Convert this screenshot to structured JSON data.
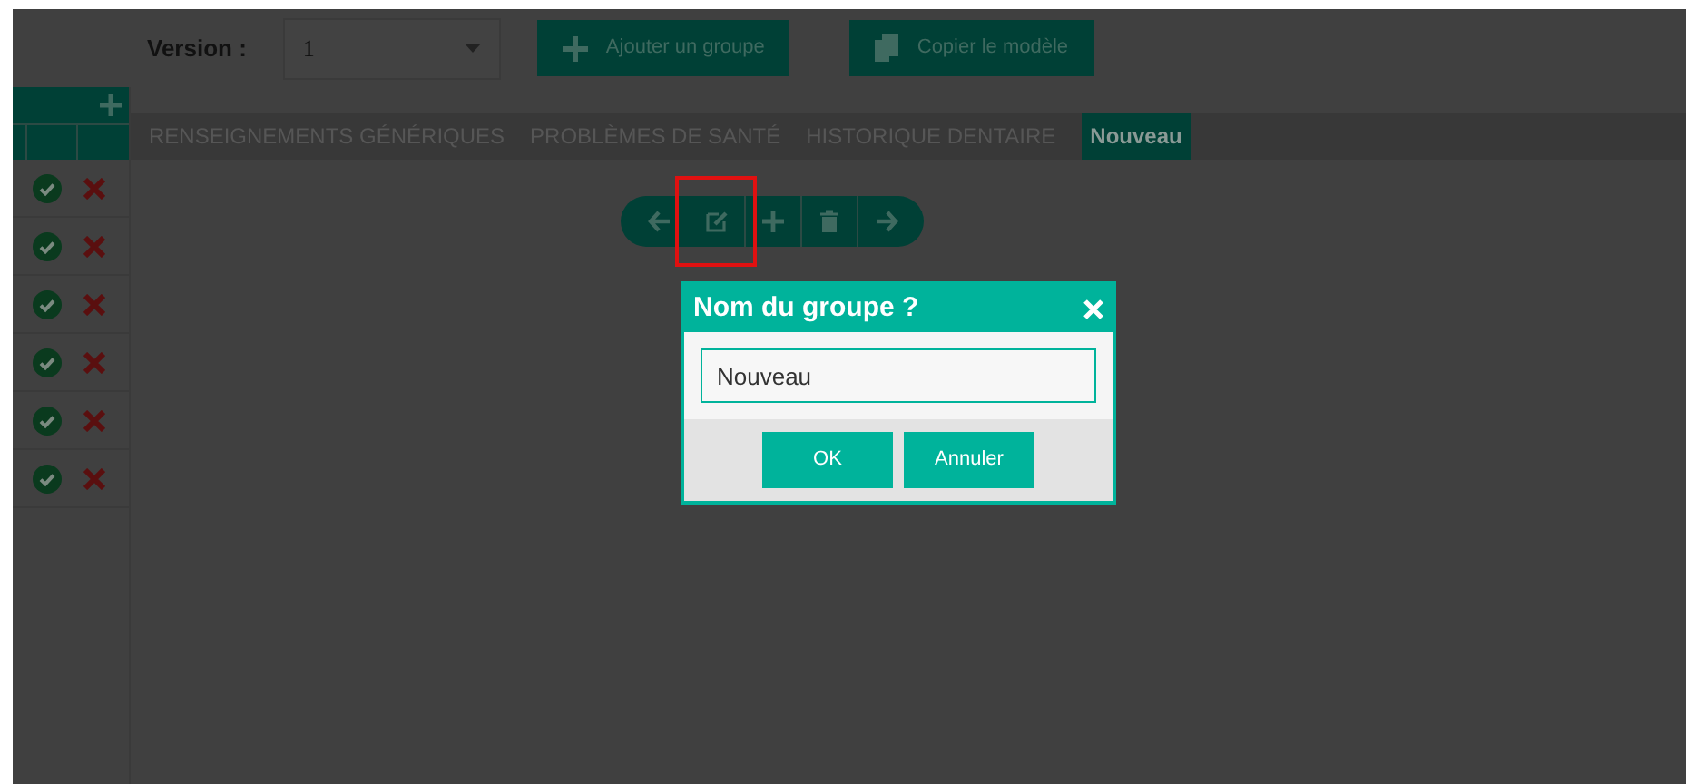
{
  "toolbar": {
    "version_label": "Version :",
    "version_value": "1",
    "buttons": [
      {
        "label": "Ajouter un groupe",
        "kind": "add"
      },
      {
        "label": "Copier le modèle",
        "kind": "copy"
      }
    ]
  },
  "side_panel": {
    "rows": [
      {
        "kind": "accept-reject"
      },
      {
        "kind": "accept-reject"
      },
      {
        "kind": "accept-reject"
      },
      {
        "kind": "accept-reject"
      },
      {
        "kind": "accept-reject"
      },
      {
        "kind": "accept-reject"
      }
    ]
  },
  "tabs": [
    {
      "label": "RENSEIGNEMENTS GÉNÉRIQUES",
      "selected": false
    },
    {
      "label": "PROBLÈMES DE SANTÉ",
      "selected": false
    },
    {
      "label": "HISTORIQUE DENTAIRE",
      "selected": false
    },
    {
      "label": "Nouveau",
      "selected": true
    }
  ],
  "group_actions": [
    {
      "kind": "prev",
      "highlighted": false
    },
    {
      "kind": "edit",
      "highlighted": true
    },
    {
      "kind": "add",
      "highlighted": false
    },
    {
      "kind": "delete",
      "highlighted": false
    },
    {
      "kind": "next",
      "highlighted": false
    }
  ],
  "dialog": {
    "title": "Nom du groupe ?",
    "value": "Nouveau",
    "buttons": [
      "OK",
      "Annuler"
    ]
  }
}
